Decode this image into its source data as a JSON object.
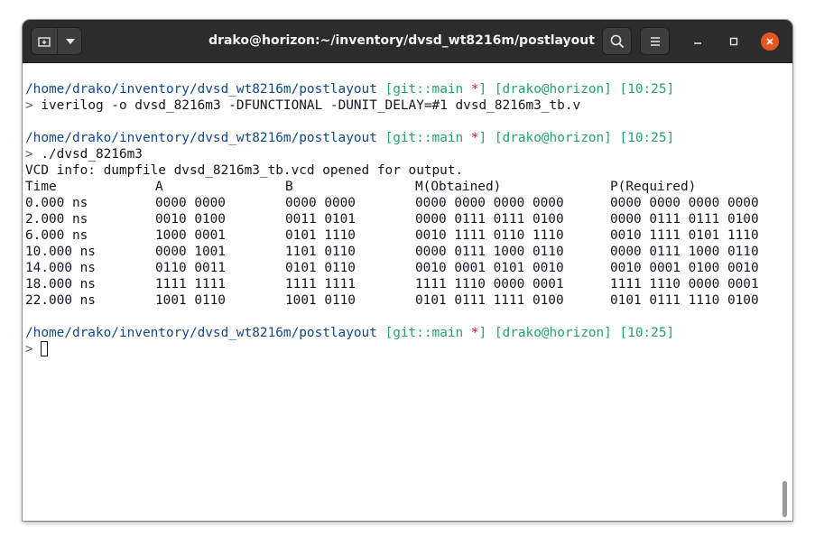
{
  "window": {
    "title": "drako@horizon:~/inventory/dvsd_wt8216m/postlayout"
  },
  "titlebar": {
    "icons": [
      "new-tab-icon",
      "dropdown-icon",
      "search-icon",
      "hamburger-menu-icon",
      "minimize-icon",
      "maximize-icon",
      "close-icon"
    ],
    "close_color": "#e95420"
  },
  "prompt": {
    "path": "/home/drako/inventory/dvsd_wt8216m/postlayout",
    "git_open": "[git::main ",
    "git_star": "*",
    "git_close": "]",
    "user": "[drako@horizon]",
    "time": "[10:25]",
    "symbol": ">"
  },
  "commands": {
    "cmd1": " iverilog -o dvsd_8216m3 -DFUNCTIONAL -DUNIT_DELAY=#1 dvsd_8216m3_tb.v",
    "cmd2": " ./dvsd_8216m3"
  },
  "output": {
    "vcd_info": "VCD info: dumpfile dvsd_8216m3_tb.vcd opened for output.",
    "headers": [
      "Time",
      "A",
      "B",
      "M(Obtained)",
      "P(Required)"
    ],
    "rows": [
      [
        "0.000 ns",
        "0000 0000",
        "0000 0000",
        "0000 0000 0000 0000",
        "0000 0000 0000 0000"
      ],
      [
        "2.000 ns",
        "0010 0100",
        "0011 0101",
        "0000 0111 0111 0100",
        "0000 0111 0111 0100"
      ],
      [
        "6.000 ns",
        "1000 0001",
        "0101 1110",
        "0010 1111 0110 1110",
        "0010 1111 0101 1110"
      ],
      [
        "10.000 ns",
        "0000 1001",
        "1101 0110",
        "0000 0111 1000 0110",
        "0000 0111 1000 0110"
      ],
      [
        "14.000 ns",
        "0110 0011",
        "0101 0110",
        "0010 0001 0101 0010",
        "0010 0001 0100 0010"
      ],
      [
        "18.000 ns",
        "1111 1111",
        "1111 1111",
        "1111 1110 0000 0001",
        "1111 1110 0000 0001"
      ],
      [
        "22.000 ns",
        "1001 0110",
        "1001 0110",
        "0101 0111 1111 0100",
        "0101 0111 1110 0100"
      ]
    ]
  },
  "colors": {
    "path": "#12488b",
    "git": "#26a269",
    "star": "#c01c28",
    "user": "#26a269",
    "time": "#26a269"
  }
}
